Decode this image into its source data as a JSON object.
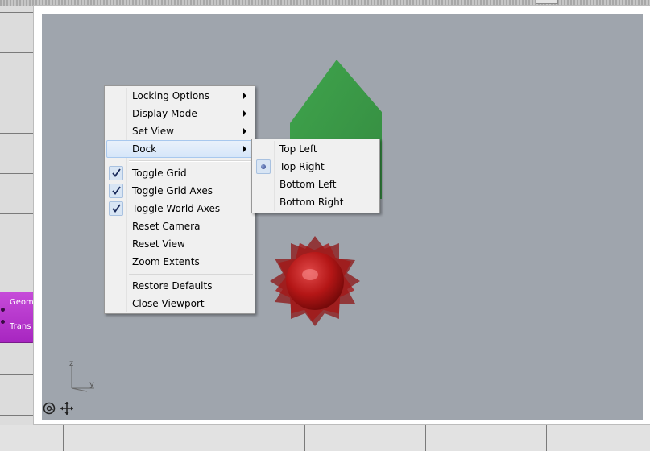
{
  "node": {
    "inputs": [
      "Geom",
      "Trans"
    ]
  },
  "menu": {
    "items": [
      {
        "label": "Locking Options",
        "submenu": true
      },
      {
        "label": "Display Mode",
        "submenu": true
      },
      {
        "label": "Set View",
        "submenu": true
      },
      {
        "label": "Dock",
        "submenu": true,
        "highlighted": true
      },
      {
        "label": "Toggle Grid",
        "checked": true
      },
      {
        "label": "Toggle Grid Axes",
        "checked": true
      },
      {
        "label": "Toggle World Axes",
        "checked": true
      },
      {
        "label": "Reset Camera"
      },
      {
        "label": "Reset View"
      },
      {
        "label": "Zoom Extents"
      },
      {
        "label": "Restore Defaults"
      },
      {
        "label": "Close Viewport"
      }
    ]
  },
  "dock_submenu": {
    "items": [
      {
        "label": "Top Left"
      },
      {
        "label": "Top Right",
        "selected": true
      },
      {
        "label": "Bottom Left"
      },
      {
        "label": "Bottom Right"
      }
    ]
  },
  "axis": {
    "z": "z",
    "y": "y"
  },
  "colors": {
    "viewport_bg": "#9fa5ad",
    "green_shape": "#3f9a47",
    "red_shape": "#b01616",
    "node_purple": "#b72fcc",
    "menu_highlight": "#d6e6f9"
  },
  "icons": [
    "orbit-icon",
    "pan-icon"
  ]
}
